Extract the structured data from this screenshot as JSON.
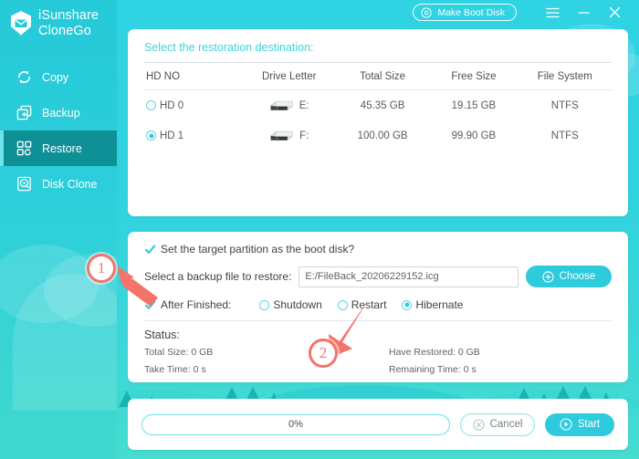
{
  "brand": {
    "line1": "iSunshare",
    "line2": "CloneGo",
    "logo_icon": "shield-logo-icon"
  },
  "sidebar": {
    "items": [
      {
        "label": "Copy",
        "icon": "refresh-circle-icon",
        "active": false
      },
      {
        "label": "Backup",
        "icon": "plus-stack-icon",
        "active": false
      },
      {
        "label": "Restore",
        "icon": "restore-blocks-icon",
        "active": true
      },
      {
        "label": "Disk Clone",
        "icon": "disk-clone-icon",
        "active": false
      }
    ]
  },
  "titlebar": {
    "make_boot_disk": "Make Boot Disk",
    "boot_disk_icon": "disc-icon",
    "menu_icon": "hamburger-menu-icon",
    "minimize_icon": "minimize-icon",
    "close_icon": "close-icon"
  },
  "destination": {
    "title": "Select the restoration destination:",
    "columns": [
      "HD NO",
      "Drive Letter",
      "Total Size",
      "Free Size",
      "File System"
    ],
    "rows": [
      {
        "hd_no": "HD 0",
        "selected": false,
        "drive_letter": "E:",
        "total_size": "45.35 GB",
        "free_size": "19.15 GB",
        "file_system": "NTFS"
      },
      {
        "hd_no": "HD 1",
        "selected": true,
        "drive_letter": "F:",
        "total_size": "100.00 GB",
        "free_size": "99.90 GB",
        "file_system": "NTFS"
      }
    ]
  },
  "options": {
    "boot_disk_checkbox": {
      "label": "Set the target partition as the boot disk?",
      "checked": true
    },
    "backup_file": {
      "label": "Select a backup file to restore:",
      "value": "E:/FileBack_20206229152.icg",
      "placeholder": "",
      "choose_label": "Choose",
      "choose_icon": "plus-circle-icon"
    },
    "after_finished": {
      "label": "After Finished:",
      "checked": true,
      "choices": [
        {
          "label": "Shutdown",
          "selected": false
        },
        {
          "label": "Restart",
          "selected": false
        },
        {
          "label": "Hibernate",
          "selected": true
        }
      ]
    },
    "status": {
      "title": "Status:",
      "total_size": "Total Size: 0 GB",
      "have_restored": "Have Restored: 0 GB",
      "take_time": "Take Time: 0 s",
      "remaining_time": "Remaining Time: 0 s"
    }
  },
  "footer": {
    "progress_label": "0%",
    "progress_percent": 0,
    "cancel_label": "Cancel",
    "cancel_icon": "x-circle-icon",
    "start_label": "Start",
    "start_icon": "play-circle-icon"
  },
  "annotations": [
    {
      "number": "1",
      "arrow_icon": "arrow-up-left-icon"
    },
    {
      "number": "2",
      "arrow_icon": "arrow-down-left-icon"
    }
  ],
  "colors": {
    "accent": "#2ecbdc",
    "sidebar_active": "#0f8f96",
    "annotation": "#f4736b",
    "background": "#2fd3e2"
  }
}
